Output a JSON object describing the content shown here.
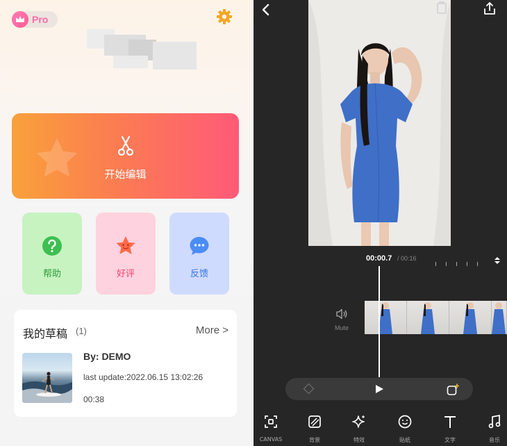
{
  "left": {
    "pro_label": "Pro",
    "edit_label": "开始编辑",
    "tiles": {
      "help": "帮助",
      "rate": "好评",
      "feedback": "反馈"
    },
    "drafts": {
      "title": "我的草稿",
      "count": "(1)",
      "more": "More >",
      "item": {
        "by": "By: DEMO",
        "last_update": "last update:2022.06.15 13:02:26",
        "duration": "00:38"
      }
    }
  },
  "right": {
    "time_current": "00:00.7",
    "time_total": "/ 00:16",
    "mute_label": "Mute",
    "toolbar": {
      "canvas": "CANVAS",
      "background": "背景",
      "effects": "特效",
      "stickers": "贴纸",
      "text": "文字",
      "music": "音乐"
    }
  },
  "colors": {
    "edit_gradient_start": "#f9a13a",
    "edit_gradient_end": "#ff5a78",
    "help_tile": "#c7f3c1",
    "rate_tile": "#fed2df",
    "feedback_tile": "#cfdaff",
    "editor_bg": "#262626"
  },
  "icons": [
    "crown-icon",
    "gear-icon",
    "scissors-icon",
    "help-icon",
    "star-face-icon",
    "chat-bubble-icon",
    "back-arrow-icon",
    "copy-icon",
    "share-icon",
    "volume-icon",
    "keyframe-icon",
    "play-icon",
    "add-keyframe-icon",
    "canvas-icon",
    "background-icon",
    "sparkle-icon",
    "sticker-icon",
    "text-icon",
    "music-icon"
  ]
}
